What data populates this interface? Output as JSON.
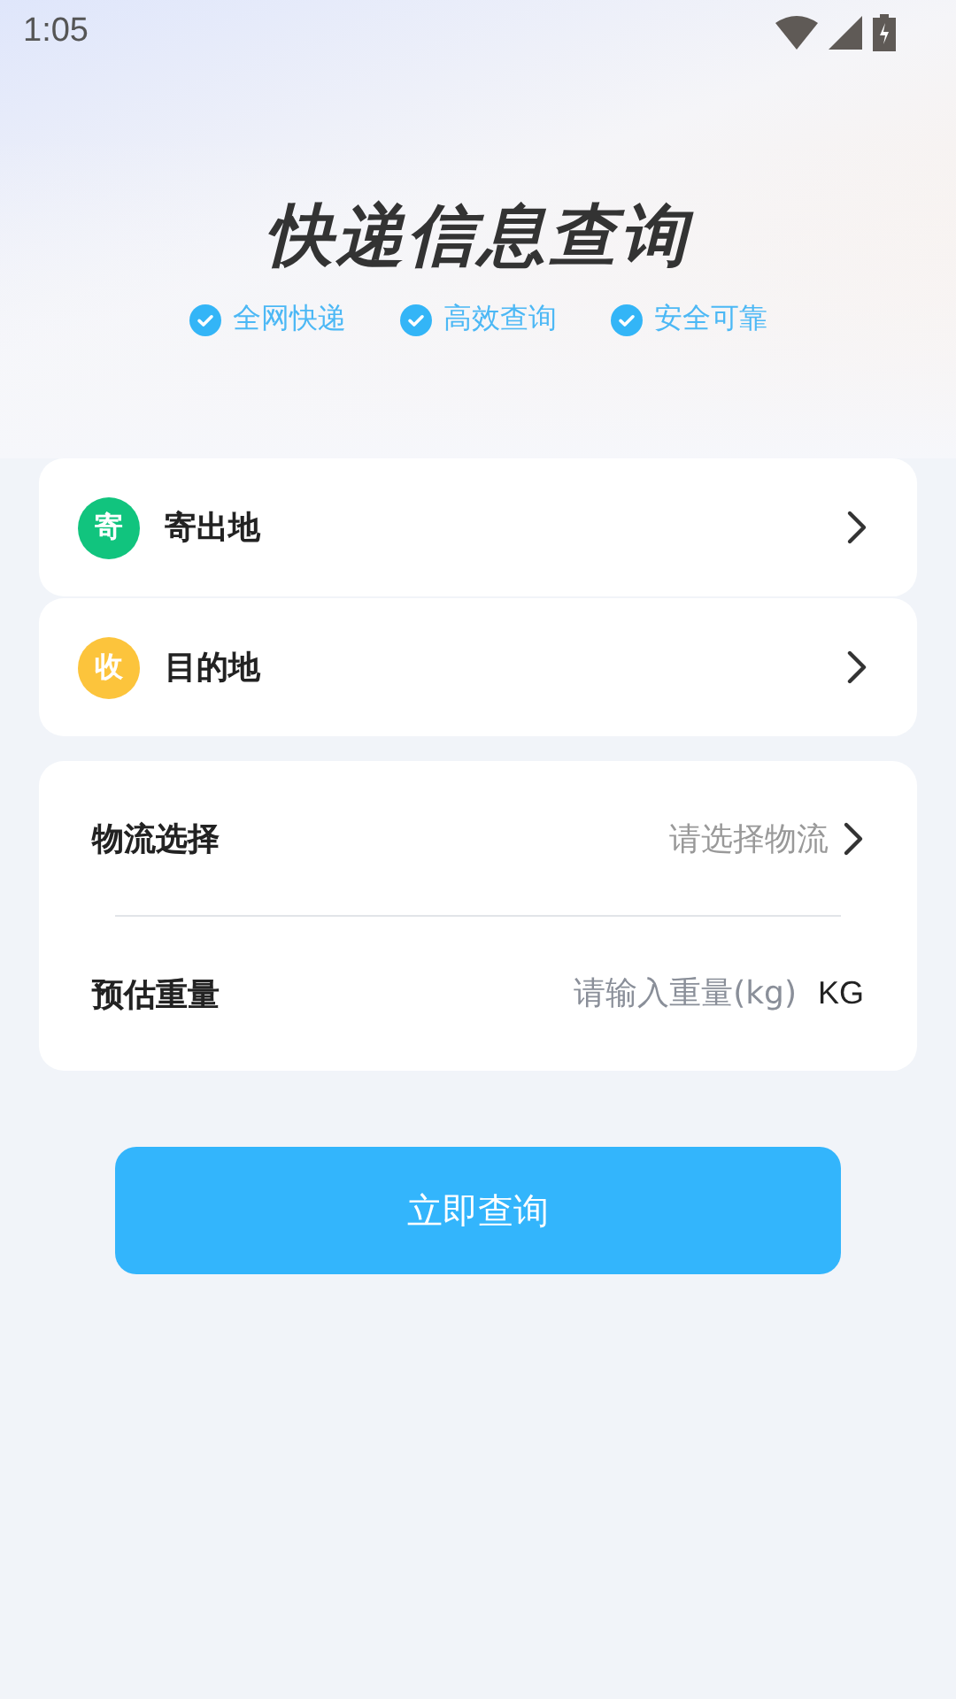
{
  "status_bar": {
    "time": "1:05"
  },
  "header": {
    "title": "快递信息查询",
    "features": [
      "全网快递",
      "高效查询",
      "安全可靠"
    ]
  },
  "locations": [
    {
      "badge": "寄",
      "color": "#11c47e",
      "label": "寄出地"
    },
    {
      "badge": "收",
      "color": "#fcc43c",
      "label": "目的地"
    }
  ],
  "form": {
    "rows": [
      {
        "kind": "picker",
        "label": "物流选择",
        "hint": "请选择物流"
      },
      {
        "kind": "input",
        "label": "预估重量",
        "placeholder": "请输入重量(kg)",
        "unit": "KG"
      }
    ]
  },
  "submit_button": "立即查询"
}
